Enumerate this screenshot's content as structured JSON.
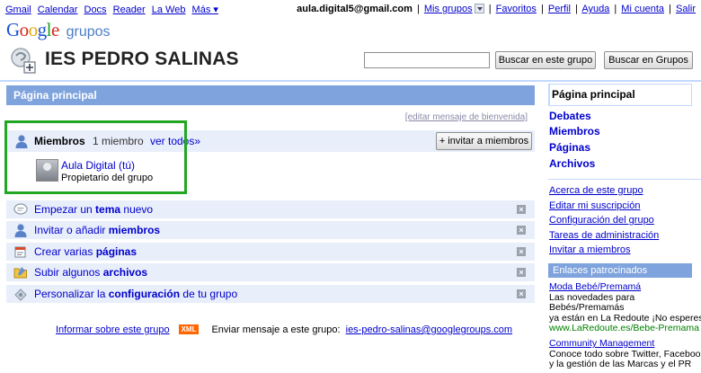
{
  "topbar": {
    "links": [
      "Gmail",
      "Calendar",
      "Docs",
      "Reader",
      "La Web",
      "Más ▾"
    ],
    "email": "aula.digital5@gmail.com",
    "right_links": [
      "Mis grupos",
      "Favoritos",
      "Perfil",
      "Ayuda",
      "Mi cuenta",
      "Salir"
    ]
  },
  "logo": {
    "google": "Google",
    "grupos": "grupos"
  },
  "header": {
    "group_name": "IES PEDRO SALINAS",
    "search_group_button": "Buscar en este grupo",
    "search_groups_button": "Buscar en Grupos",
    "search_value": ""
  },
  "main": {
    "title": "Página principal",
    "edit_welcome": "[editar mensaje de bienvenida]",
    "members": {
      "title": "Miembros",
      "count": "1 miembro",
      "see_all": "ver todos»",
      "invite_button": "+ invitar a miembros",
      "list": [
        {
          "name": "Aula Digital (tú)",
          "role": "Propietario del grupo"
        }
      ]
    },
    "tasks": [
      {
        "pre": "Empezar un ",
        "bold": "tema",
        "post": " nuevo",
        "icon": "speech-bubble-icon"
      },
      {
        "pre": "Invitar o añadir ",
        "bold": "miembros",
        "post": "",
        "icon": "person-icon"
      },
      {
        "pre": "Crear varias ",
        "bold": "páginas",
        "post": "",
        "icon": "page-icon"
      },
      {
        "pre": "Subir algunos ",
        "bold": "archivos",
        "post": "",
        "icon": "folder-icon"
      },
      {
        "pre": "Personalizar la ",
        "bold": "configuración",
        "post": " de tu grupo",
        "icon": "settings-icon"
      }
    ],
    "footer": {
      "report": "Informar sobre este grupo",
      "xml": "XML",
      "send_label": "Enviar mensaje a este grupo:",
      "group_email": "ies-pedro-salinas@googlegroups.com"
    }
  },
  "sidebar": {
    "current": "Página principal",
    "nav": [
      "Debates",
      "Miembros",
      "Páginas",
      "Archivos"
    ],
    "links": [
      "Acerca de este grupo",
      "Editar mi suscripción",
      "Configuración del grupo",
      "Tareas de administración",
      "Invitar a miembros"
    ],
    "sponsored": "Enlaces patrocinados",
    "ads": [
      {
        "title": "Moda Bebé/Premamá",
        "lines": [
          "Las novedades para",
          "Bebés/Premamás",
          "ya están en La Redoute ¡No esperes!"
        ],
        "url": "www.LaRedoute.es/Bebe-Premama"
      },
      {
        "title": "Community Management",
        "lines": [
          "Conoce todo sobre Twitter, Facebook",
          "y la gestión de las Marcas y el PR"
        ],
        "url": ""
      }
    ]
  },
  "colors": {
    "accent_bar": "#7fa3dd",
    "row_bg": "#e8eefa",
    "highlight_box": "#22a722",
    "link": "#0000cc"
  }
}
